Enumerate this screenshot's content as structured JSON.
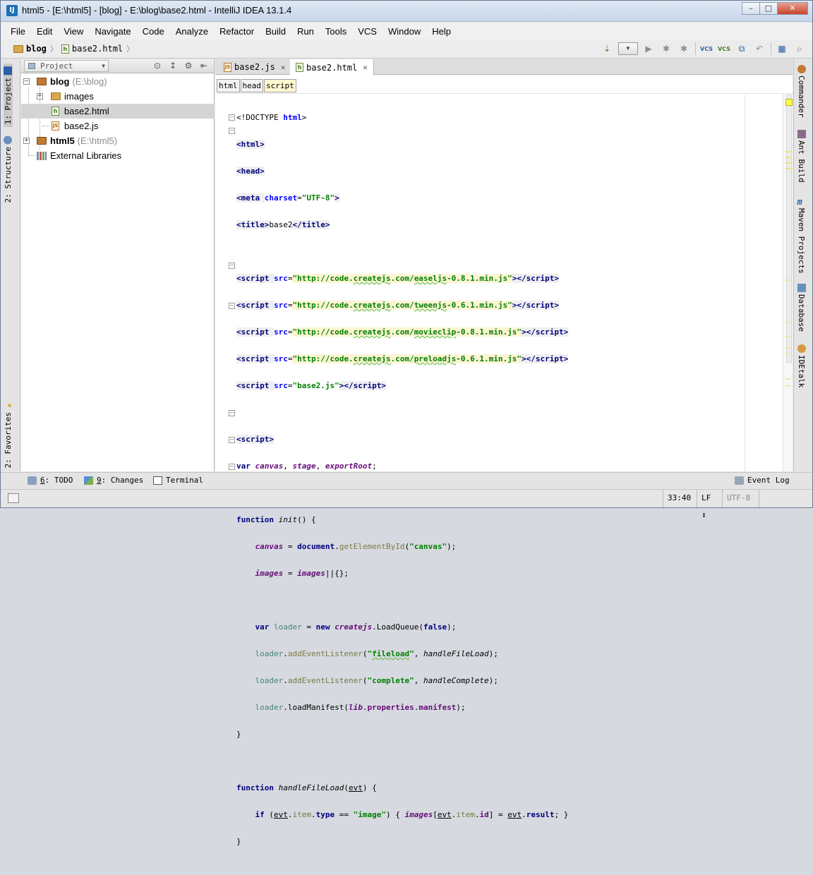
{
  "window": {
    "title": "html5 - [E:\\html5] - [blog] - E:\\blog\\base2.html - IntelliJ IDEA 13.1.4",
    "minimize": "–",
    "maximize": "□",
    "close": "✕",
    "app_icon": "IJ"
  },
  "menu": [
    "File",
    "Edit",
    "View",
    "Navigate",
    "Code",
    "Analyze",
    "Refactor",
    "Build",
    "Run",
    "Tools",
    "VCS",
    "Window",
    "Help"
  ],
  "navbar": {
    "crumbs": [
      {
        "label": "blog",
        "icon": "folder-icon"
      },
      {
        "label": "base2.html",
        "icon": "html-file-icon"
      }
    ],
    "toolbar": [
      {
        "name": "make-project-icon",
        "glyph": "⇣"
      },
      {
        "name": "run-icon",
        "glyph": "▶"
      },
      {
        "name": "debug-icon",
        "glyph": "✱"
      },
      {
        "name": "coverage-icon",
        "glyph": "✱"
      },
      {
        "name": "vcs-update-icon",
        "glyph": "VCS"
      },
      {
        "name": "vcs-commit-icon",
        "glyph": "VCS"
      },
      {
        "name": "compare-icon",
        "glyph": "⧉"
      },
      {
        "name": "revert-icon",
        "glyph": "↶"
      },
      {
        "name": "project-structure-icon",
        "glyph": "▦"
      },
      {
        "name": "search-icon",
        "glyph": "⌕"
      }
    ]
  },
  "left_stripe": {
    "tabs": [
      "1: Project",
      "2: Structure",
      "2: Favorites"
    ]
  },
  "project_panel": {
    "combo": "Project",
    "tools": [
      "⊙",
      "↕",
      "⚙",
      "⇤"
    ],
    "tree": [
      {
        "label": "blog",
        "hint": "(E:\\blog)",
        "bold": true,
        "icon": "folder-icon"
      },
      {
        "label": "images",
        "hint": "",
        "bold": false,
        "icon": "folder-icon"
      },
      {
        "label": "base2.html",
        "hint": "",
        "bold": false,
        "icon": "html-file-icon"
      },
      {
        "label": "base2.js",
        "hint": "",
        "bold": false,
        "icon": "js-file-icon"
      },
      {
        "label": "html5",
        "hint": "(E:\\html5)",
        "bold": true,
        "icon": "folder-icon"
      },
      {
        "label": "External Libraries",
        "hint": "",
        "bold": false,
        "icon": "library-icon"
      }
    ]
  },
  "editor": {
    "tabs": [
      {
        "label": "base2.js",
        "icon": "js-file-icon",
        "close": "✕"
      },
      {
        "label": "base2.html",
        "icon": "html-file-icon",
        "close": "✕"
      }
    ],
    "tag_path": [
      "html",
      "head",
      "script"
    ]
  },
  "right_stripe": {
    "tabs": [
      "Commander",
      "Ant Build",
      "Maven Projects",
      "Database",
      "IDEtalk"
    ]
  },
  "bottom_tools": [
    {
      "prefix": "6",
      "label": ": TODO"
    },
    {
      "prefix": "9",
      "label": ": Changes"
    },
    {
      "prefix": "",
      "label": "Terminal"
    }
  ],
  "event_log": "Event Log",
  "status": {
    "position": "33:40",
    "line_sep": "LF ↕",
    "encoding": "UTF-8"
  },
  "colors": {
    "accent": "#1d6fb8",
    "keyword": "#000080",
    "string": "#008000",
    "field": "#660e7a"
  }
}
